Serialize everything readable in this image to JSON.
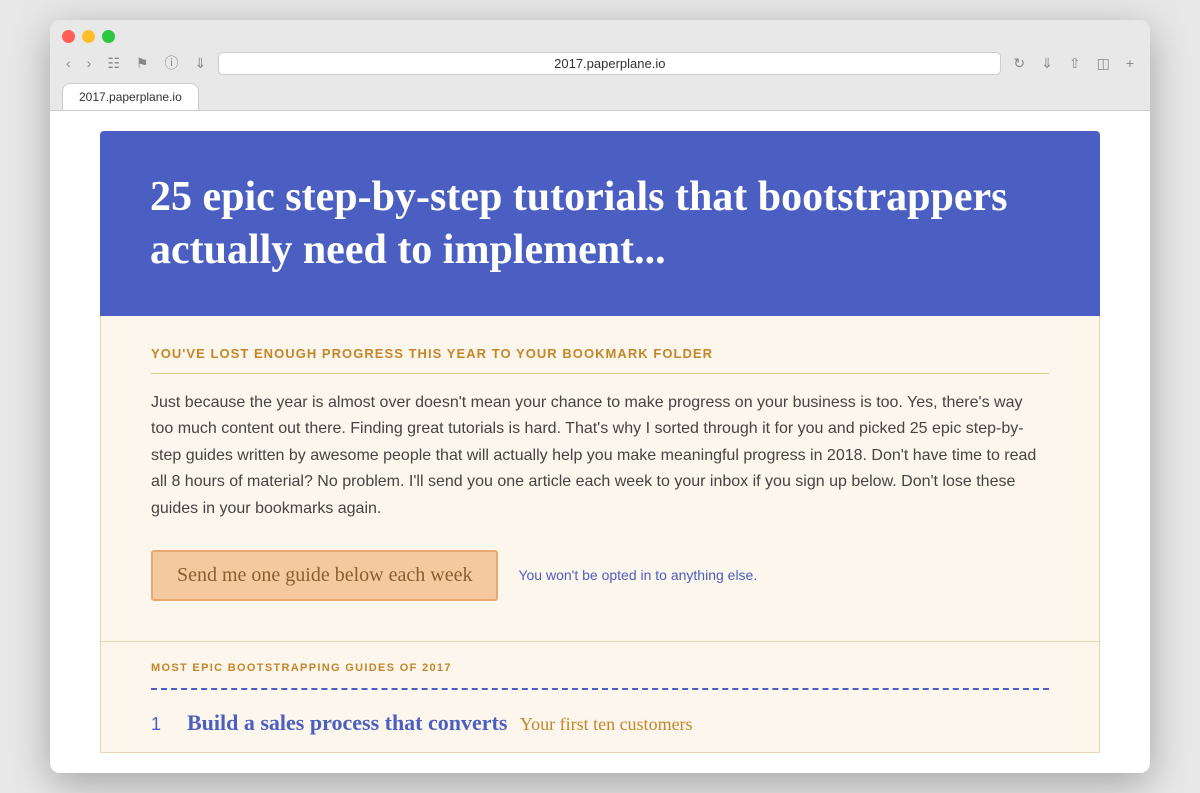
{
  "browser": {
    "url": "2017.paperplane.io",
    "tab_label": "2017.paperplane.io"
  },
  "hero": {
    "title": "25 epic step-by-step tutorials that bootstrappers actually need to implement..."
  },
  "content": {
    "subheading": "YOU'VE LOST ENOUGH PROGRESS THIS YEAR TO YOUR BOOKMARK FOLDER",
    "body": "Just because the year is almost over doesn't mean your chance to make progress on your business is too. Yes, there's way too much content out there. Finding great tutorials is hard. That's why I sorted through it for you and picked 25 epic step-by-step guides written by awesome people that will actually help you make meaningful progress in 2018. Don't have time to read all 8 hours of material? No problem. I'll send you one article each week to your inbox if you sign up below. Don't lose these guides in your bookmarks again.",
    "cta_button": "Send me one guide below each week",
    "cta_note": "You won't be opted in to anything else."
  },
  "guides": {
    "section_label": "MOST EPIC BOOTSTRAPPING GUIDES OF 2017",
    "items": [
      {
        "number": "1",
        "title": "Build a sales process that converts",
        "subtitle": "Your first ten customers"
      }
    ]
  }
}
